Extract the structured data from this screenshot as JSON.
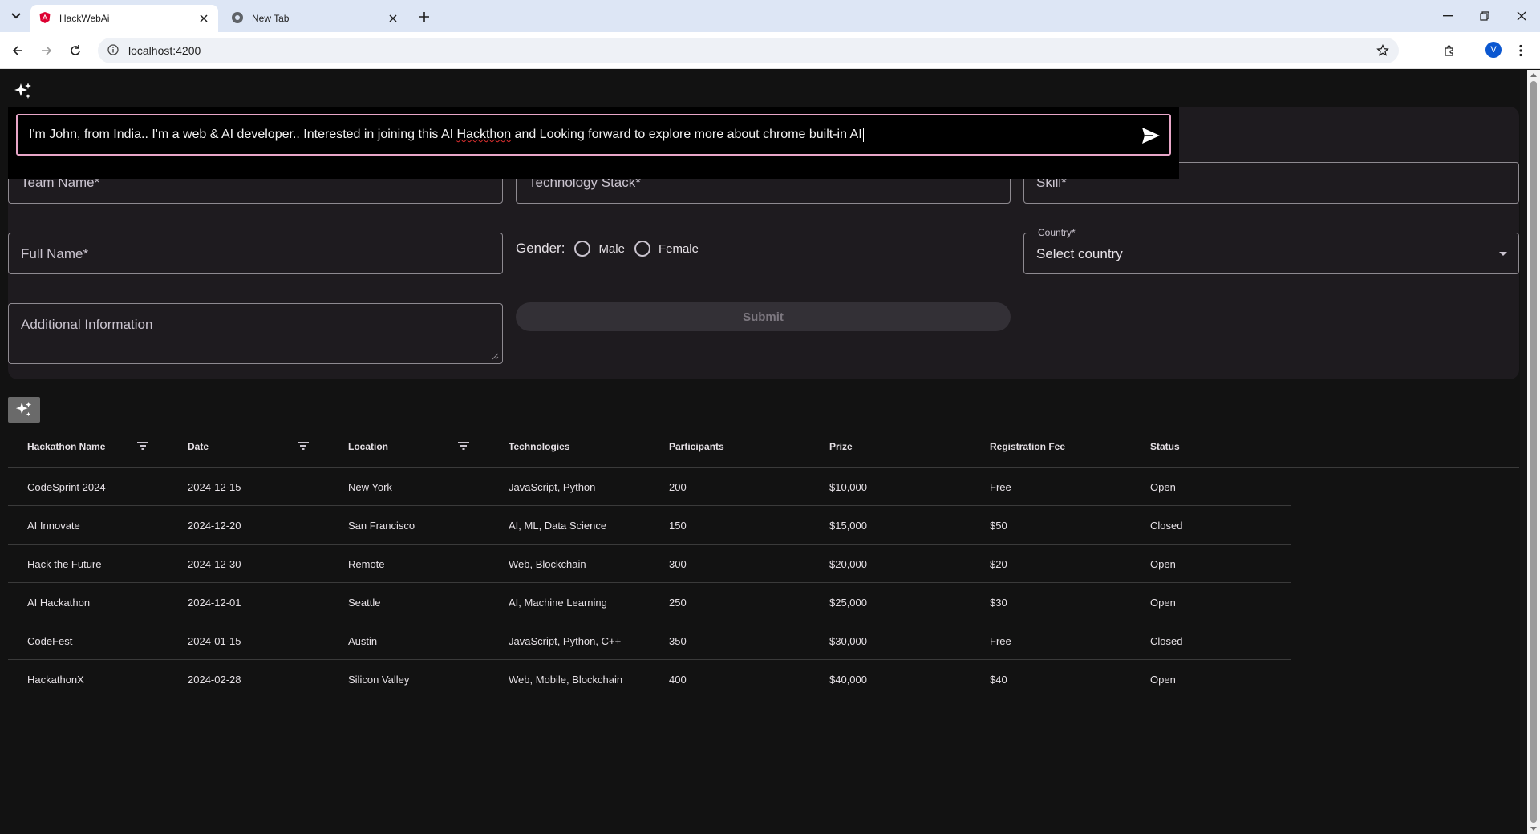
{
  "browser": {
    "tabs": [
      {
        "title": "HackWebAi",
        "active": true
      },
      {
        "title": "New Tab",
        "active": false
      }
    ],
    "url": "localhost:4200",
    "profile_initial": "V"
  },
  "ai_prompt": {
    "text_before": "I'm John, from India.. I'm a web & AI developer.. Interested in joining this AI ",
    "misspelled": "Hackthon",
    "text_after": " and Looking forward to explore more about chrome built-in AI"
  },
  "form": {
    "team_name_label": "Team Name*",
    "tech_stack_label": "Technology Stack*",
    "skill_label": "Skill*",
    "full_name_label": "Full Name*",
    "gender_label": "Gender:",
    "gender_options": [
      "Male",
      "Female"
    ],
    "country_label": "Country*",
    "country_value": "Select country",
    "additional_info_label": "Additional Information",
    "submit_label": "Submit"
  },
  "table": {
    "columns": [
      "Hackathon Name",
      "Date",
      "Location",
      "Technologies",
      "Participants",
      "Prize",
      "Registration Fee",
      "Status"
    ],
    "rows": [
      [
        "CodeSprint 2024",
        "2024-12-15",
        "New York",
        "JavaScript, Python",
        "200",
        "$10,000",
        "Free",
        "Open"
      ],
      [
        "AI Innovate",
        "2024-12-20",
        "San Francisco",
        "AI, ML, Data Science",
        "150",
        "$15,000",
        "$50",
        "Closed"
      ],
      [
        "Hack the Future",
        "2024-12-30",
        "Remote",
        "Web, Blockchain",
        "300",
        "$20,000",
        "$20",
        "Open"
      ],
      [
        "AI Hackathon",
        "2024-12-01",
        "Seattle",
        "AI, Machine Learning",
        "250",
        "$25,000",
        "$30",
        "Open"
      ],
      [
        "CodeFest",
        "2024-01-15",
        "Austin",
        "JavaScript, Python, C++",
        "350",
        "$30,000",
        "Free",
        "Closed"
      ],
      [
        "HackathonX",
        "2024-02-28",
        "Silicon Valley",
        "Web, Mobile, Blockchain",
        "400",
        "$40,000",
        "$40",
        "Open"
      ]
    ]
  },
  "icons": {
    "sparkle": "sparkle-icon",
    "send": "send-icon",
    "filter": "filter-icon"
  },
  "colors": {
    "background": "#121212",
    "card": "#1e1b1f",
    "prompt_border": "#e8a6c8"
  }
}
